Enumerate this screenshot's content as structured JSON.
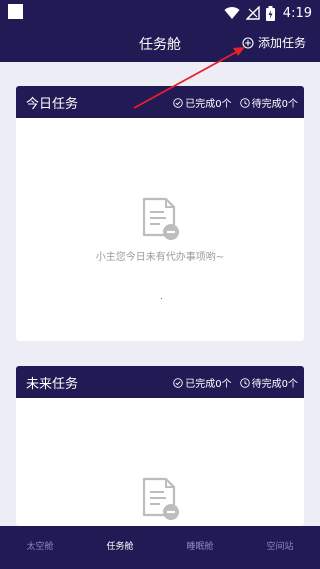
{
  "status": {
    "time": "4:19"
  },
  "header": {
    "title": "任务舱",
    "add_label": "添加任务"
  },
  "today": {
    "title": "今日任务",
    "done_label": "已完成0个",
    "pending_label": "待完成0个",
    "empty_text": "小主您今日未有代办事项哟~"
  },
  "future": {
    "title": "未来任务",
    "done_label": "已完成0个",
    "pending_label": "待完成0个"
  },
  "nav": {
    "items": [
      {
        "label": "太空舱"
      },
      {
        "label": "任务舱"
      },
      {
        "label": "睡眠舱"
      },
      {
        "label": "空间站"
      }
    ],
    "active_index": 1
  },
  "colors": {
    "primary": "#221a55",
    "background": "#ecedf5",
    "annotation": "#e8202a",
    "nav_inactive": "#8c88c4"
  },
  "icons": [
    "wifi-icon",
    "signal-icon",
    "battery-icon",
    "add-circle-icon",
    "check-circle-icon",
    "clock-icon",
    "empty-document-icon"
  ]
}
